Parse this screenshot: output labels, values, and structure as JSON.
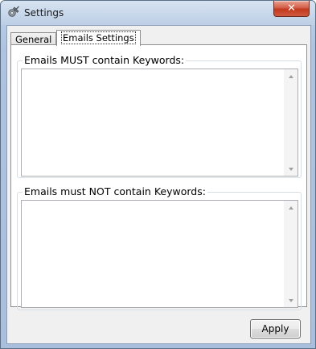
{
  "window": {
    "title": "Settings",
    "icon": "settings-gear-icon",
    "close_glyph": "✕"
  },
  "tabs": [
    {
      "label": "General",
      "selected": false
    },
    {
      "label": "Emails Settings",
      "selected": true
    }
  ],
  "email_settings": {
    "must_contain": {
      "label": "Emails MUST contain Keywords:",
      "value": ""
    },
    "must_not_contain": {
      "label": "Emails must NOT contain Keywords:",
      "value": ""
    }
  },
  "footer": {
    "apply_label": "Apply"
  }
}
